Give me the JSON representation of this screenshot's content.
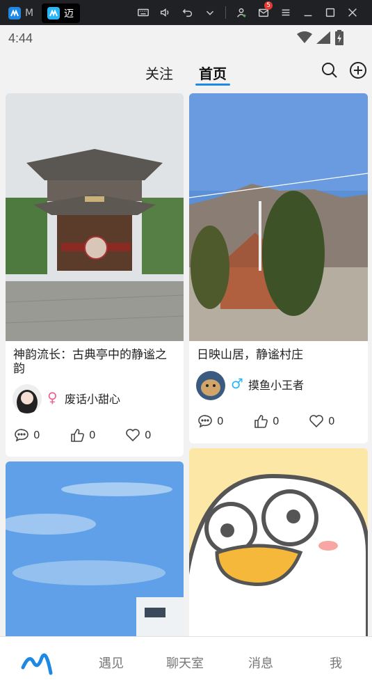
{
  "emulator": {
    "tabs": [
      {
        "label": "M"
      },
      {
        "label": "迈"
      }
    ],
    "mail_badge": "5"
  },
  "status": {
    "time": "4:44"
  },
  "header": {
    "tabs": [
      {
        "label": "关注"
      },
      {
        "label": "首页"
      }
    ],
    "active_tab": "首页"
  },
  "feed": [
    {
      "title": "神韵流长：古典亭中的静谧之韵",
      "username": "废话小甜心",
      "gender": "♀",
      "gender_color": "#f06292",
      "comments": "0",
      "likes": "0",
      "favorites": "0"
    },
    {
      "title": "日映山居，静谧村庄",
      "username": "摸鱼小王者",
      "gender": "♂",
      "gender_color": "#29b6f6",
      "comments": "0",
      "likes": "0",
      "favorites": "0"
    }
  ],
  "bottom_nav": {
    "items": [
      {
        "label": "遇见"
      },
      {
        "label": "聊天室"
      },
      {
        "label": "消息"
      },
      {
        "label": "我"
      }
    ]
  },
  "colors": {
    "accent": "#1e88e5"
  }
}
